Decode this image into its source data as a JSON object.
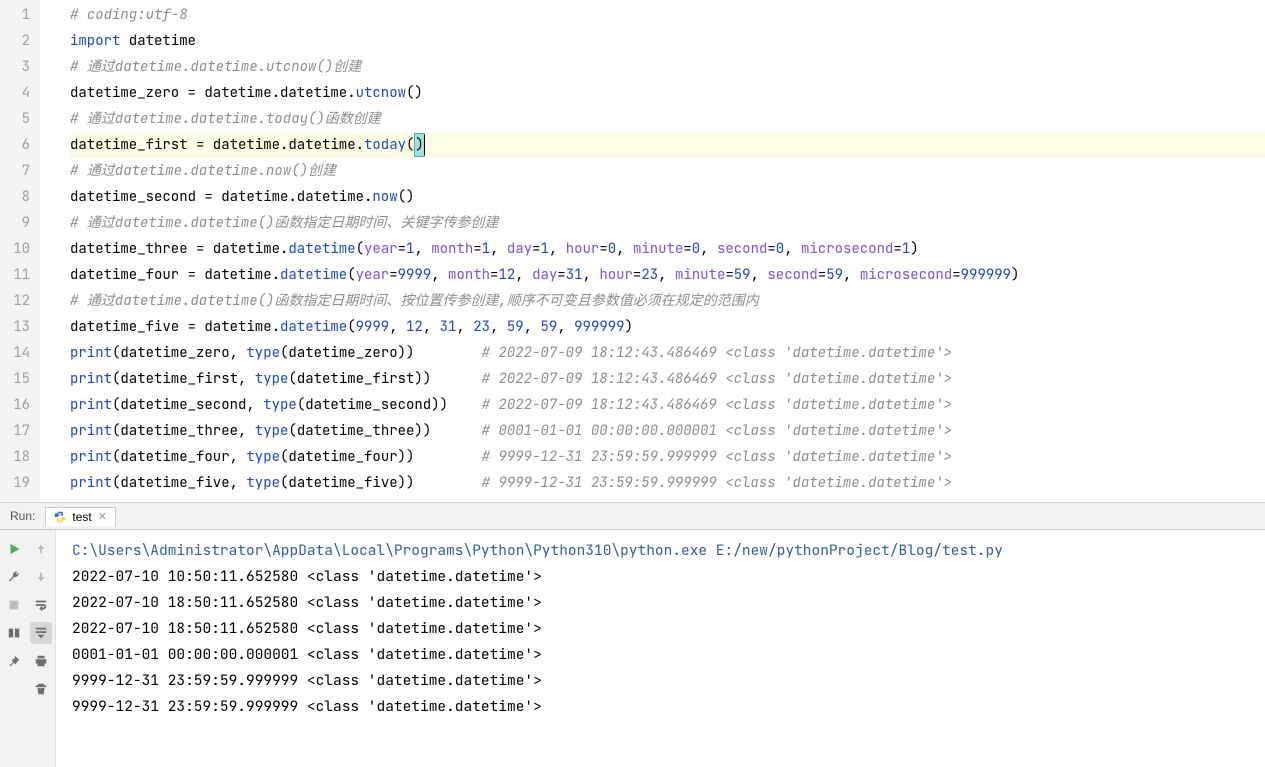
{
  "editor": {
    "lineNumbers": [
      "1",
      "2",
      "3",
      "4",
      "5",
      "6",
      "7",
      "8",
      "9",
      "10",
      "11",
      "12",
      "13",
      "14",
      "15",
      "16",
      "17",
      "18",
      "19"
    ],
    "lines": [
      {
        "t": "comment",
        "text": "# coding:utf-8"
      },
      {
        "t": "import",
        "kw": "import",
        "mod": " datetime"
      },
      {
        "t": "comment",
        "text": "# 通过datetime.datetime.utcnow()创建"
      },
      {
        "t": "assign",
        "lhs": "datetime_zero = datetime.datetime.",
        "call": "utcnow",
        "args": "()"
      },
      {
        "t": "comment",
        "text": "# 通过datetime.datetime.today()函数创建"
      },
      {
        "t": "assign_hl",
        "lhs": "datetime_first = datetime.datetime.",
        "call": "today",
        "args_open": "(",
        "args_close": ")"
      },
      {
        "t": "comment",
        "text": "# 通过datetime.datetime.now()创建"
      },
      {
        "t": "assign",
        "lhs": "datetime_second = datetime.datetime.",
        "call": "now",
        "args": "()"
      },
      {
        "t": "comment",
        "text": "# 通过datetime.datetime()函数指定日期时间、关键字传参创建"
      },
      {
        "t": "kwcall",
        "lhs": "datetime_three = datetime.",
        "call": "datetime",
        "pairs": [
          [
            "year",
            "1"
          ],
          [
            "month",
            "1"
          ],
          [
            "day",
            "1"
          ],
          [
            "hour",
            "0"
          ],
          [
            "minute",
            "0"
          ],
          [
            "second",
            "0"
          ],
          [
            "microsecond",
            "1"
          ]
        ]
      },
      {
        "t": "kwcall",
        "lhs": "datetime_four = datetime.",
        "call": "datetime",
        "pairs": [
          [
            "year",
            "9999"
          ],
          [
            "month",
            "12"
          ],
          [
            "day",
            "31"
          ],
          [
            "hour",
            "23"
          ],
          [
            "minute",
            "59"
          ],
          [
            "second",
            "59"
          ],
          [
            "microsecond",
            "999999"
          ]
        ]
      },
      {
        "t": "comment",
        "text": "# 通过datetime.datetime()函数指定日期时间、按位置传参创建,顺序不可变且参数值必须在规定的范围内"
      },
      {
        "t": "poscall",
        "lhs": "datetime_five = datetime.",
        "call": "datetime",
        "vals": [
          "9999",
          "12",
          "31",
          "23",
          "59",
          "59",
          "999999"
        ]
      },
      {
        "t": "print",
        "args": "(datetime_zero, ",
        "ty": "type",
        "args2": "(datetime_zero))",
        "pad": "        ",
        "cm": "# 2022-07-09 18:12:43.486469 <class 'datetime.datetime'>"
      },
      {
        "t": "print",
        "args": "(datetime_first, ",
        "ty": "type",
        "args2": "(datetime_first))",
        "pad": "      ",
        "cm": "# 2022-07-09 18:12:43.486469 <class 'datetime.datetime'>"
      },
      {
        "t": "print",
        "args": "(datetime_second, ",
        "ty": "type",
        "args2": "(datetime_second))",
        "pad": "    ",
        "cm": "# 2022-07-09 18:12:43.486469 <class 'datetime.datetime'>"
      },
      {
        "t": "print",
        "args": "(datetime_three, ",
        "ty": "type",
        "args2": "(datetime_three))",
        "pad": "      ",
        "cm": "# 0001-01-01 00:00:00.000001 <class 'datetime.datetime'>"
      },
      {
        "t": "print",
        "args": "(datetime_four, ",
        "ty": "type",
        "args2": "(datetime_four))",
        "pad": "        ",
        "cm": "# 9999-12-31 23:59:59.999999 <class 'datetime.datetime'>"
      },
      {
        "t": "print",
        "args": "(datetime_five, ",
        "ty": "type",
        "args2": "(datetime_five))",
        "pad": "        ",
        "cm": "# 9999-12-31 23:59:59.999999 <class 'datetime.datetime'>"
      }
    ]
  },
  "runTab": {
    "label": "Run:",
    "name": "test"
  },
  "console": {
    "cmd": "C:\\Users\\Administrator\\AppData\\Local\\Programs\\Python\\Python310\\python.exe E:/new/pythonProject/Blog/test.py",
    "out": [
      "2022-07-10 10:50:11.652580 <class 'datetime.datetime'>",
      "2022-07-10 18:50:11.652580 <class 'datetime.datetime'>",
      "2022-07-10 18:50:11.652580 <class 'datetime.datetime'>",
      "0001-01-01 00:00:00.000001 <class 'datetime.datetime'>",
      "9999-12-31 23:59:59.999999 <class 'datetime.datetime'>",
      "9999-12-31 23:59:59.999999 <class 'datetime.datetime'>"
    ]
  }
}
